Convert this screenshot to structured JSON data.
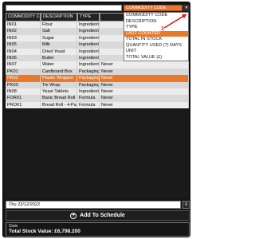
{
  "search": {
    "value": "",
    "placeholder": ""
  },
  "sort": {
    "selected": "COMMODITY CODE",
    "options": [
      "COMMODITY CODE",
      "DESCRIPTION",
      "TYPE",
      "LAST COUNTED",
      "TOTAL IN STOCK",
      "QUANTITY USED (7) DAYS",
      "UNIT",
      "TOTAL VALUE (£)"
    ],
    "highlighted": "LAST COUNTED"
  },
  "annotation": {
    "number": "1"
  },
  "table": {
    "headers": [
      "COMMODITY CODE",
      "DESCRIPTION",
      "TYPE",
      ""
    ],
    "rows": [
      {
        "code": "IN01",
        "desc": "Flour",
        "type": "Ingredient",
        "last": ""
      },
      {
        "code": "IN02",
        "desc": "Salt",
        "type": "Ingredient",
        "last": ""
      },
      {
        "code": "IN03",
        "desc": "Sugar",
        "type": "Ingredient",
        "last": ""
      },
      {
        "code": "IN05",
        "desc": "Milk",
        "type": "Ingredient",
        "last": ""
      },
      {
        "code": "IN04",
        "desc": "Dried Yeast",
        "type": "Ingredient",
        "last": ""
      },
      {
        "code": "IN06",
        "desc": "Butter",
        "type": "Ingredient",
        "last": ""
      },
      {
        "code": "IN07",
        "desc": "Water",
        "type": "Ingredient",
        "last": "Never"
      },
      {
        "code": "PK01",
        "desc": "Cardboard Box",
        "type": "Packaging",
        "last": "Never"
      },
      {
        "code": "PK02",
        "desc": "Plastic Wrapper",
        "type": "Packaging",
        "last": "Never"
      },
      {
        "code": "PK03",
        "desc": "Tie Wrap",
        "type": "Packaging",
        "last": "Never"
      },
      {
        "code": "IN08",
        "desc": "Yeast Tablets",
        "type": "Ingredient",
        "last": "Never"
      },
      {
        "code": "FOR01",
        "desc": "Basic Bread Roll",
        "type": "Formula",
        "last": "Never"
      },
      {
        "code": "PRO01",
        "desc": "Bread Roll - 4-Pack",
        "type": "Formula",
        "last": "Never"
      }
    ],
    "selected_index": 8
  },
  "date": {
    "value": "Thu 22/12/2022",
    "button_label": "≡"
  },
  "add_button": {
    "label": "Add To Schedule"
  },
  "stats": {
    "title": "Stats",
    "value": "Total Stock Value: £6,798.200"
  },
  "colors": {
    "accent": "#e8792b",
    "background": "#161616"
  }
}
